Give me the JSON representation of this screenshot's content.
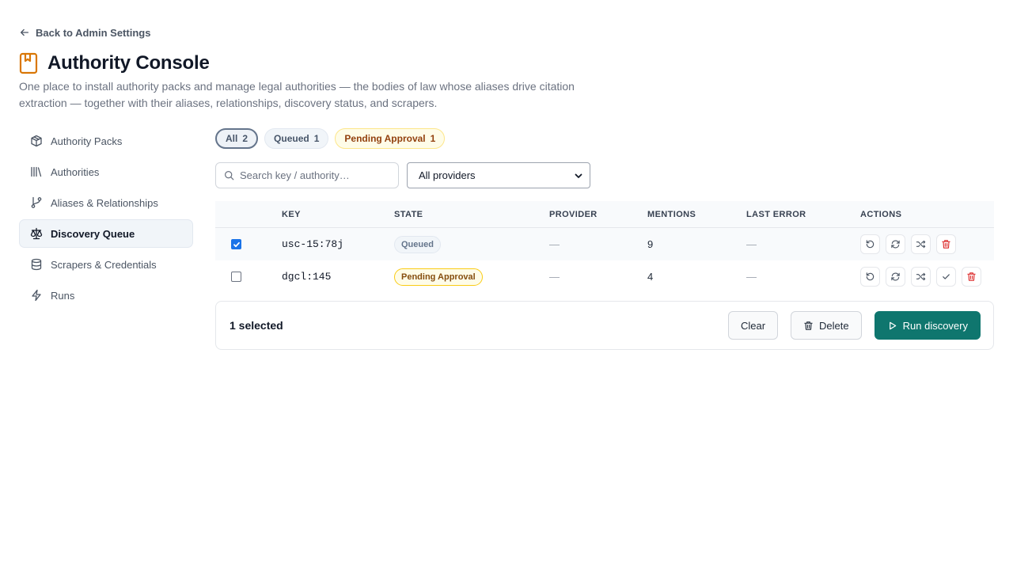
{
  "back_link": "Back to Admin Settings",
  "title": "Authority Console",
  "subtitle": "One place to install authority packs and manage legal authorities — the bodies of law whose aliases drive citation extraction — together with their aliases, relationships, discovery status, and scrapers.",
  "sidebar": {
    "items": [
      {
        "label": "Authority Packs",
        "icon": "package-icon"
      },
      {
        "label": "Authorities",
        "icon": "library-icon"
      },
      {
        "label": "Aliases & Relationships",
        "icon": "git-branch-icon"
      },
      {
        "label": "Discovery Queue",
        "icon": "scale-icon",
        "active": true
      },
      {
        "label": "Scrapers & Credentials",
        "icon": "database-icon"
      },
      {
        "label": "Runs",
        "icon": "zap-icon"
      }
    ]
  },
  "filters": [
    {
      "label": "All",
      "count": "2",
      "active": true
    },
    {
      "label": "Queued",
      "count": "1"
    },
    {
      "label": "Pending Approval",
      "count": "1"
    }
  ],
  "search": {
    "placeholder": "Search key / authority…"
  },
  "provider_select": {
    "value": "All providers"
  },
  "table": {
    "columns": [
      "KEY",
      "STATE",
      "PROVIDER",
      "MENTIONS",
      "LAST ERROR",
      "ACTIONS"
    ],
    "rows": [
      {
        "key": "usc-15:78j",
        "state": "Queued",
        "provider": "—",
        "mentions": "9",
        "last_error": "—",
        "checked": true
      },
      {
        "key": "dgcl:145",
        "state": "Pending Approval",
        "provider": "—",
        "mentions": "4",
        "last_error": "—",
        "checked": false
      }
    ]
  },
  "bulk": {
    "selected": "1 selected",
    "clear": "Clear",
    "delete": "Delete",
    "run": "Run discovery"
  },
  "colors": {
    "accent": "#0f766e",
    "brand_icon": "#d97706",
    "danger": "#dc2626",
    "pending_bg": "#fefce8"
  }
}
